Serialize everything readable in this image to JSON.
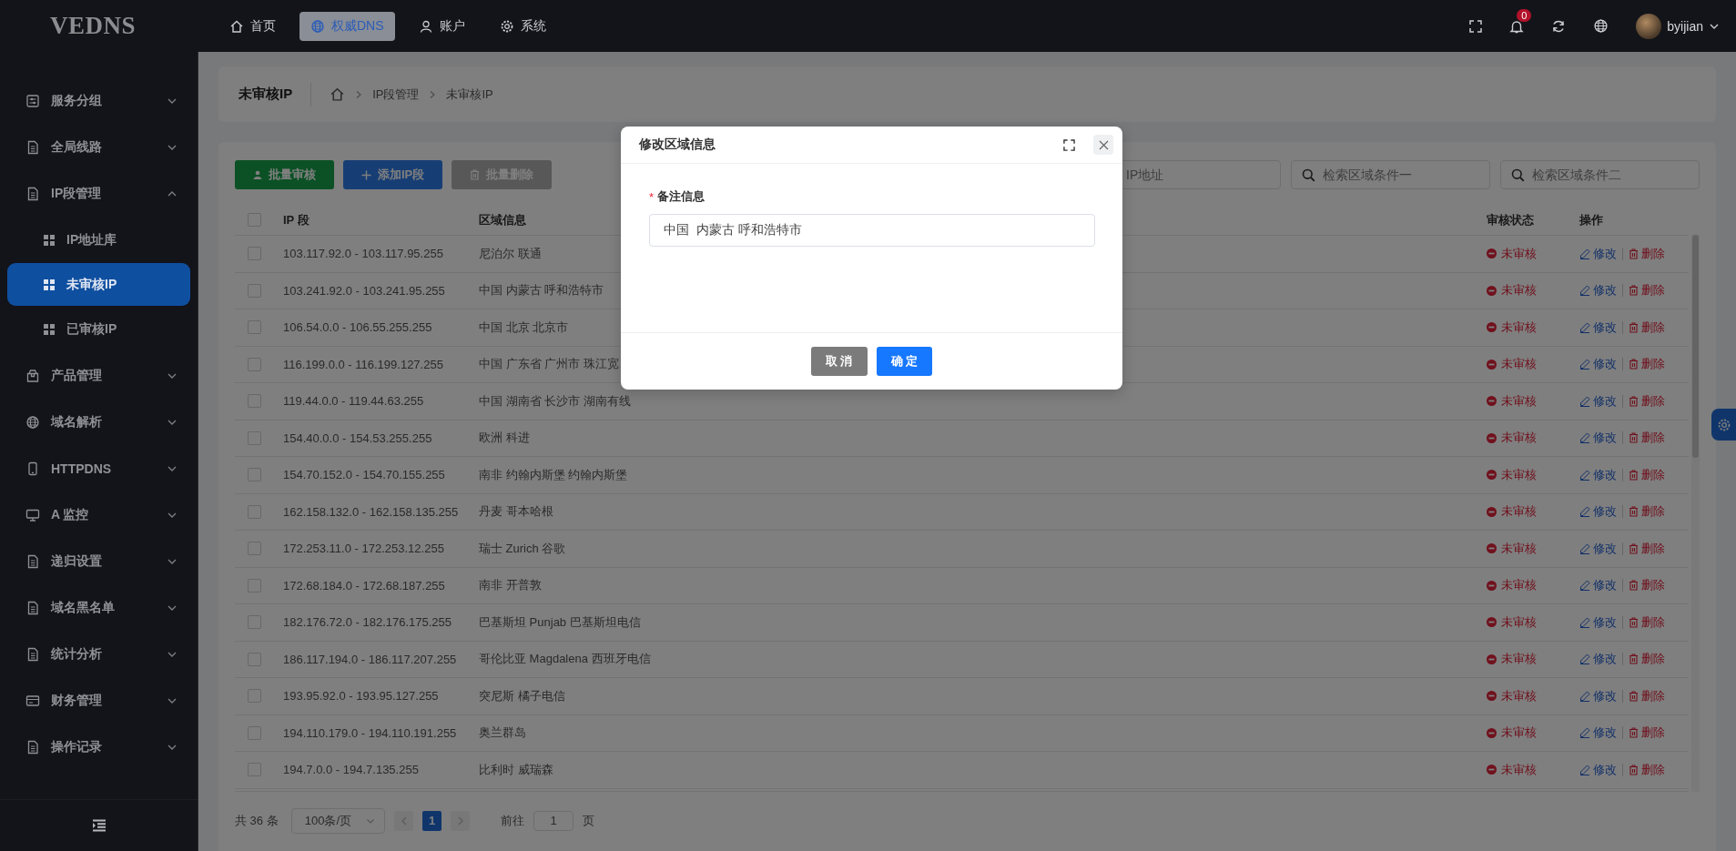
{
  "topbar": {
    "logo": "VEDNS",
    "nav": [
      {
        "label": "首页",
        "selected": false
      },
      {
        "label": "权威DNS",
        "selected": true
      },
      {
        "label": "账户",
        "selected": false
      },
      {
        "label": "系统",
        "selected": false
      }
    ],
    "notification_badge": "0",
    "user": "byijian"
  },
  "sidebar": {
    "items": [
      {
        "label": "服务分组",
        "expanded": false
      },
      {
        "label": "全局线路",
        "expanded": false
      },
      {
        "label": "IP段管理",
        "expanded": true,
        "children": [
          {
            "label": "IP地址库",
            "selected": false
          },
          {
            "label": "未审核IP",
            "selected": true
          },
          {
            "label": "已审核IP",
            "selected": false
          }
        ]
      },
      {
        "label": "产品管理",
        "expanded": false
      },
      {
        "label": "域名解析",
        "expanded": false
      },
      {
        "label": "HTTPDNS",
        "expanded": false
      },
      {
        "label": "A 监控",
        "expanded": false
      },
      {
        "label": "递归设置",
        "expanded": false
      },
      {
        "label": "域名黑名单",
        "expanded": false
      },
      {
        "label": "统计分析",
        "expanded": false
      },
      {
        "label": "财务管理",
        "expanded": false
      },
      {
        "label": "操作记录",
        "expanded": false
      }
    ]
  },
  "header": {
    "title": "未审核IP",
    "breadcrumb": [
      "IP段管理",
      "未审核IP"
    ]
  },
  "toolbar": {
    "buttons": [
      {
        "label": "批量审核",
        "kind": "approve"
      },
      {
        "label": "添加IP段",
        "kind": "add"
      },
      {
        "label": "批量删除",
        "kind": "delete"
      }
    ],
    "search": [
      {
        "placeholder": "IP地址"
      },
      {
        "placeholder": "检索区域条件一"
      },
      {
        "placeholder": "检索区域条件二"
      }
    ]
  },
  "table": {
    "header_checked": false,
    "columns": [
      "IP 段",
      "区域信息",
      "审核状态",
      "操作"
    ],
    "rows": [
      {
        "checked": false,
        "ip": "103.117.92.0 - 103.117.95.255",
        "region": "尼泊尔 联通",
        "status": "未审核",
        "actions": [
          "修改",
          "删除"
        ]
      },
      {
        "checked": false,
        "ip": "103.241.92.0 - 103.241.95.255",
        "region": "中国 内蒙古 呼和浩特市",
        "status": "未审核",
        "actions": [
          "修改",
          "删除"
        ]
      },
      {
        "checked": false,
        "ip": "106.54.0.0 - 106.55.255.255",
        "region": "中国 北京 北京市",
        "status": "未审核",
        "actions": [
          "修改",
          "删除"
        ]
      },
      {
        "checked": false,
        "ip": "116.199.0.0 - 116.199.127.255",
        "region": "中国 广东省 广州市 珠江宽",
        "status": "未审核",
        "actions": [
          "修改",
          "删除"
        ]
      },
      {
        "checked": false,
        "ip": "119.44.0.0 - 119.44.63.255",
        "region": "中国 湖南省 长沙市 湖南有线",
        "status": "未审核",
        "actions": [
          "修改",
          "删除"
        ]
      },
      {
        "checked": false,
        "ip": "154.40.0.0 - 154.53.255.255",
        "region": "欧洲 科进",
        "status": "未审核",
        "actions": [
          "修改",
          "删除"
        ]
      },
      {
        "checked": false,
        "ip": "154.70.152.0 - 154.70.155.255",
        "region": "南非 约翰内斯堡 约翰内斯堡",
        "status": "未审核",
        "actions": [
          "修改",
          "删除"
        ]
      },
      {
        "checked": false,
        "ip": "162.158.132.0 - 162.158.135.255",
        "region": "丹麦 哥本哈根",
        "status": "未审核",
        "actions": [
          "修改",
          "删除"
        ]
      },
      {
        "checked": false,
        "ip": "172.253.11.0 - 172.253.12.255",
        "region": "瑞士 Zurich 谷歌",
        "status": "未审核",
        "actions": [
          "修改",
          "删除"
        ]
      },
      {
        "checked": false,
        "ip": "172.68.184.0 - 172.68.187.255",
        "region": "南非 开普敦",
        "status": "未审核",
        "actions": [
          "修改",
          "删除"
        ]
      },
      {
        "checked": false,
        "ip": "182.176.72.0 - 182.176.175.255",
        "region": "巴基斯坦 Punjab 巴基斯坦电信",
        "status": "未审核",
        "actions": [
          "修改",
          "删除"
        ]
      },
      {
        "checked": false,
        "ip": "186.117.194.0 - 186.117.207.255",
        "region": "哥伦比亚 Magdalena 西班牙电信",
        "status": "未审核",
        "actions": [
          "修改",
          "删除"
        ]
      },
      {
        "checked": false,
        "ip": "193.95.92.0 - 193.95.127.255",
        "region": "突尼斯 橘子电信",
        "status": "未审核",
        "actions": [
          "修改",
          "删除"
        ]
      },
      {
        "checked": false,
        "ip": "194.110.179.0 - 194.110.191.255",
        "region": "奥兰群岛",
        "status": "未审核",
        "actions": [
          "修改",
          "删除"
        ]
      },
      {
        "checked": false,
        "ip": "194.7.0.0 - 194.7.135.255",
        "region": "比利时 威瑞森",
        "status": "未审核",
        "actions": [
          "修改",
          "删除"
        ]
      }
    ]
  },
  "pagination": {
    "total": "共 36 条",
    "page_size": "100条/页",
    "pages": [
      {
        "label": "1",
        "selected": true
      }
    ],
    "goto_label": "前往",
    "goto_value": "1",
    "goto_suffix": "页"
  },
  "dialog": {
    "title": "修改区域信息",
    "field": {
      "required_marker": "*",
      "label": "备注信息",
      "value": "中国  内蒙古 呼和浩特市"
    },
    "buttons": [
      {
        "label": "取 消",
        "kind": "cancel"
      },
      {
        "label": "确 定",
        "kind": "confirm"
      }
    ]
  }
}
